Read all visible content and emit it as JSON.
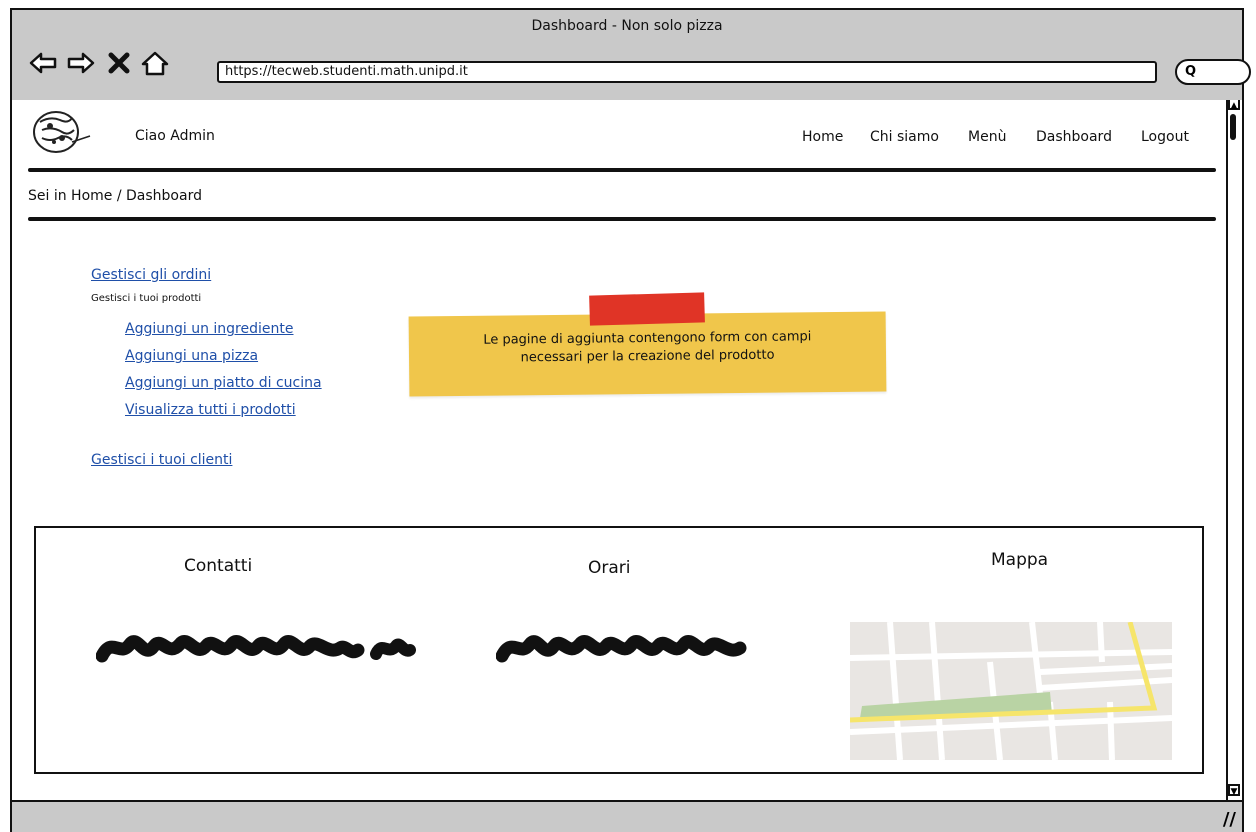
{
  "window": {
    "title": "Dashboard - Non solo pizza",
    "url": "https://tecweb.studenti.math.unipd.it",
    "search_glyph": "Q"
  },
  "toolbar": {
    "back_icon": "back-arrow-icon",
    "forward_icon": "forward-arrow-icon",
    "stop_icon": "close-icon",
    "home_icon": "home-icon"
  },
  "header": {
    "greeting": "Ciao Admin",
    "nav": [
      "Home",
      "Chi siamo",
      "Menù",
      "Dashboard",
      "Logout"
    ]
  },
  "breadcrumb": "Sei in Home / Dashboard",
  "menu": {
    "orders": "Gestisci gli ordini",
    "products_heading": "Gestisci i tuoi prodotti",
    "products": [
      "Aggiungi un ingrediente",
      "Aggiungi una pizza",
      "Aggiungi un piatto di cucina",
      "Visualizza tutti i prodotti"
    ],
    "clients": "Gestisci i tuoi clienti"
  },
  "note": {
    "line1": "Le pagine di aggiunta contengono form con campi",
    "line2": "necessari per la creazione del prodotto"
  },
  "footer": {
    "contacts": "Contatti",
    "hours": "Orari",
    "map": "Mappa"
  },
  "colors": {
    "link": "#1f4fa8",
    "note": "#f0c64b",
    "tape": "#e03426",
    "chrome": "#c9c9c9"
  }
}
